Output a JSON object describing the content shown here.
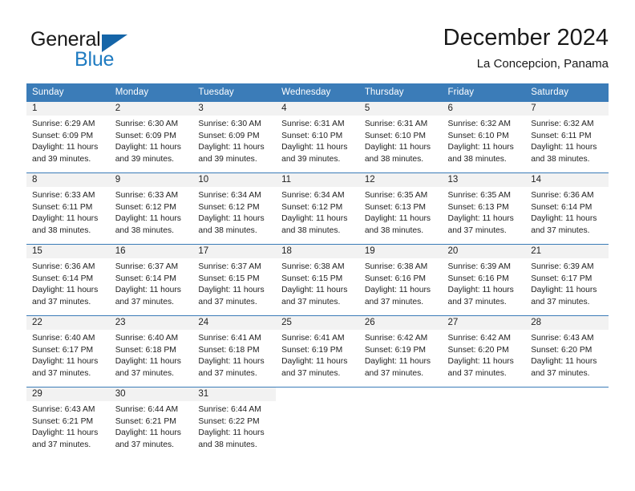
{
  "brand": {
    "name_part1": "General",
    "name_part2": "Blue",
    "color_dark": "#1a1a1a",
    "color_blue": "#1f7bc1",
    "triangle_color": "#1565a8"
  },
  "header": {
    "title": "December 2024",
    "subtitle": "La Concepcion, Panama",
    "accent_color": "#3b7cb8",
    "band_color": "#f2f2f2"
  },
  "calendar": {
    "weekday_headers": [
      "Sunday",
      "Monday",
      "Tuesday",
      "Wednesday",
      "Thursday",
      "Friday",
      "Saturday"
    ],
    "weeks": [
      [
        {
          "day": "1",
          "sunrise": "Sunrise: 6:29 AM",
          "sunset": "Sunset: 6:09 PM",
          "daylight_line1": "Daylight: 11 hours",
          "daylight_line2": "and 39 minutes."
        },
        {
          "day": "2",
          "sunrise": "Sunrise: 6:30 AM",
          "sunset": "Sunset: 6:09 PM",
          "daylight_line1": "Daylight: 11 hours",
          "daylight_line2": "and 39 minutes."
        },
        {
          "day": "3",
          "sunrise": "Sunrise: 6:30 AM",
          "sunset": "Sunset: 6:09 PM",
          "daylight_line1": "Daylight: 11 hours",
          "daylight_line2": "and 39 minutes."
        },
        {
          "day": "4",
          "sunrise": "Sunrise: 6:31 AM",
          "sunset": "Sunset: 6:10 PM",
          "daylight_line1": "Daylight: 11 hours",
          "daylight_line2": "and 39 minutes."
        },
        {
          "day": "5",
          "sunrise": "Sunrise: 6:31 AM",
          "sunset": "Sunset: 6:10 PM",
          "daylight_line1": "Daylight: 11 hours",
          "daylight_line2": "and 38 minutes."
        },
        {
          "day": "6",
          "sunrise": "Sunrise: 6:32 AM",
          "sunset": "Sunset: 6:10 PM",
          "daylight_line1": "Daylight: 11 hours",
          "daylight_line2": "and 38 minutes."
        },
        {
          "day": "7",
          "sunrise": "Sunrise: 6:32 AM",
          "sunset": "Sunset: 6:11 PM",
          "daylight_line1": "Daylight: 11 hours",
          "daylight_line2": "and 38 minutes."
        }
      ],
      [
        {
          "day": "8",
          "sunrise": "Sunrise: 6:33 AM",
          "sunset": "Sunset: 6:11 PM",
          "daylight_line1": "Daylight: 11 hours",
          "daylight_line2": "and 38 minutes."
        },
        {
          "day": "9",
          "sunrise": "Sunrise: 6:33 AM",
          "sunset": "Sunset: 6:12 PM",
          "daylight_line1": "Daylight: 11 hours",
          "daylight_line2": "and 38 minutes."
        },
        {
          "day": "10",
          "sunrise": "Sunrise: 6:34 AM",
          "sunset": "Sunset: 6:12 PM",
          "daylight_line1": "Daylight: 11 hours",
          "daylight_line2": "and 38 minutes."
        },
        {
          "day": "11",
          "sunrise": "Sunrise: 6:34 AM",
          "sunset": "Sunset: 6:12 PM",
          "daylight_line1": "Daylight: 11 hours",
          "daylight_line2": "and 38 minutes."
        },
        {
          "day": "12",
          "sunrise": "Sunrise: 6:35 AM",
          "sunset": "Sunset: 6:13 PM",
          "daylight_line1": "Daylight: 11 hours",
          "daylight_line2": "and 38 minutes."
        },
        {
          "day": "13",
          "sunrise": "Sunrise: 6:35 AM",
          "sunset": "Sunset: 6:13 PM",
          "daylight_line1": "Daylight: 11 hours",
          "daylight_line2": "and 37 minutes."
        },
        {
          "day": "14",
          "sunrise": "Sunrise: 6:36 AM",
          "sunset": "Sunset: 6:14 PM",
          "daylight_line1": "Daylight: 11 hours",
          "daylight_line2": "and 37 minutes."
        }
      ],
      [
        {
          "day": "15",
          "sunrise": "Sunrise: 6:36 AM",
          "sunset": "Sunset: 6:14 PM",
          "daylight_line1": "Daylight: 11 hours",
          "daylight_line2": "and 37 minutes."
        },
        {
          "day": "16",
          "sunrise": "Sunrise: 6:37 AM",
          "sunset": "Sunset: 6:14 PM",
          "daylight_line1": "Daylight: 11 hours",
          "daylight_line2": "and 37 minutes."
        },
        {
          "day": "17",
          "sunrise": "Sunrise: 6:37 AM",
          "sunset": "Sunset: 6:15 PM",
          "daylight_line1": "Daylight: 11 hours",
          "daylight_line2": "and 37 minutes."
        },
        {
          "day": "18",
          "sunrise": "Sunrise: 6:38 AM",
          "sunset": "Sunset: 6:15 PM",
          "daylight_line1": "Daylight: 11 hours",
          "daylight_line2": "and 37 minutes."
        },
        {
          "day": "19",
          "sunrise": "Sunrise: 6:38 AM",
          "sunset": "Sunset: 6:16 PM",
          "daylight_line1": "Daylight: 11 hours",
          "daylight_line2": "and 37 minutes."
        },
        {
          "day": "20",
          "sunrise": "Sunrise: 6:39 AM",
          "sunset": "Sunset: 6:16 PM",
          "daylight_line1": "Daylight: 11 hours",
          "daylight_line2": "and 37 minutes."
        },
        {
          "day": "21",
          "sunrise": "Sunrise: 6:39 AM",
          "sunset": "Sunset: 6:17 PM",
          "daylight_line1": "Daylight: 11 hours",
          "daylight_line2": "and 37 minutes."
        }
      ],
      [
        {
          "day": "22",
          "sunrise": "Sunrise: 6:40 AM",
          "sunset": "Sunset: 6:17 PM",
          "daylight_line1": "Daylight: 11 hours",
          "daylight_line2": "and 37 minutes."
        },
        {
          "day": "23",
          "sunrise": "Sunrise: 6:40 AM",
          "sunset": "Sunset: 6:18 PM",
          "daylight_line1": "Daylight: 11 hours",
          "daylight_line2": "and 37 minutes."
        },
        {
          "day": "24",
          "sunrise": "Sunrise: 6:41 AM",
          "sunset": "Sunset: 6:18 PM",
          "daylight_line1": "Daylight: 11 hours",
          "daylight_line2": "and 37 minutes."
        },
        {
          "day": "25",
          "sunrise": "Sunrise: 6:41 AM",
          "sunset": "Sunset: 6:19 PM",
          "daylight_line1": "Daylight: 11 hours",
          "daylight_line2": "and 37 minutes."
        },
        {
          "day": "26",
          "sunrise": "Sunrise: 6:42 AM",
          "sunset": "Sunset: 6:19 PM",
          "daylight_line1": "Daylight: 11 hours",
          "daylight_line2": "and 37 minutes."
        },
        {
          "day": "27",
          "sunrise": "Sunrise: 6:42 AM",
          "sunset": "Sunset: 6:20 PM",
          "daylight_line1": "Daylight: 11 hours",
          "daylight_line2": "and 37 minutes."
        },
        {
          "day": "28",
          "sunrise": "Sunrise: 6:43 AM",
          "sunset": "Sunset: 6:20 PM",
          "daylight_line1": "Daylight: 11 hours",
          "daylight_line2": "and 37 minutes."
        }
      ],
      [
        {
          "day": "29",
          "sunrise": "Sunrise: 6:43 AM",
          "sunset": "Sunset: 6:21 PM",
          "daylight_line1": "Daylight: 11 hours",
          "daylight_line2": "and 37 minutes."
        },
        {
          "day": "30",
          "sunrise": "Sunrise: 6:44 AM",
          "sunset": "Sunset: 6:21 PM",
          "daylight_line1": "Daylight: 11 hours",
          "daylight_line2": "and 37 minutes."
        },
        {
          "day": "31",
          "sunrise": "Sunrise: 6:44 AM",
          "sunset": "Sunset: 6:22 PM",
          "daylight_line1": "Daylight: 11 hours",
          "daylight_line2": "and 38 minutes."
        },
        {
          "day": "",
          "sunrise": "",
          "sunset": "",
          "daylight_line1": "",
          "daylight_line2": ""
        },
        {
          "day": "",
          "sunrise": "",
          "sunset": "",
          "daylight_line1": "",
          "daylight_line2": ""
        },
        {
          "day": "",
          "sunrise": "",
          "sunset": "",
          "daylight_line1": "",
          "daylight_line2": ""
        },
        {
          "day": "",
          "sunrise": "",
          "sunset": "",
          "daylight_line1": "",
          "daylight_line2": ""
        }
      ]
    ]
  }
}
